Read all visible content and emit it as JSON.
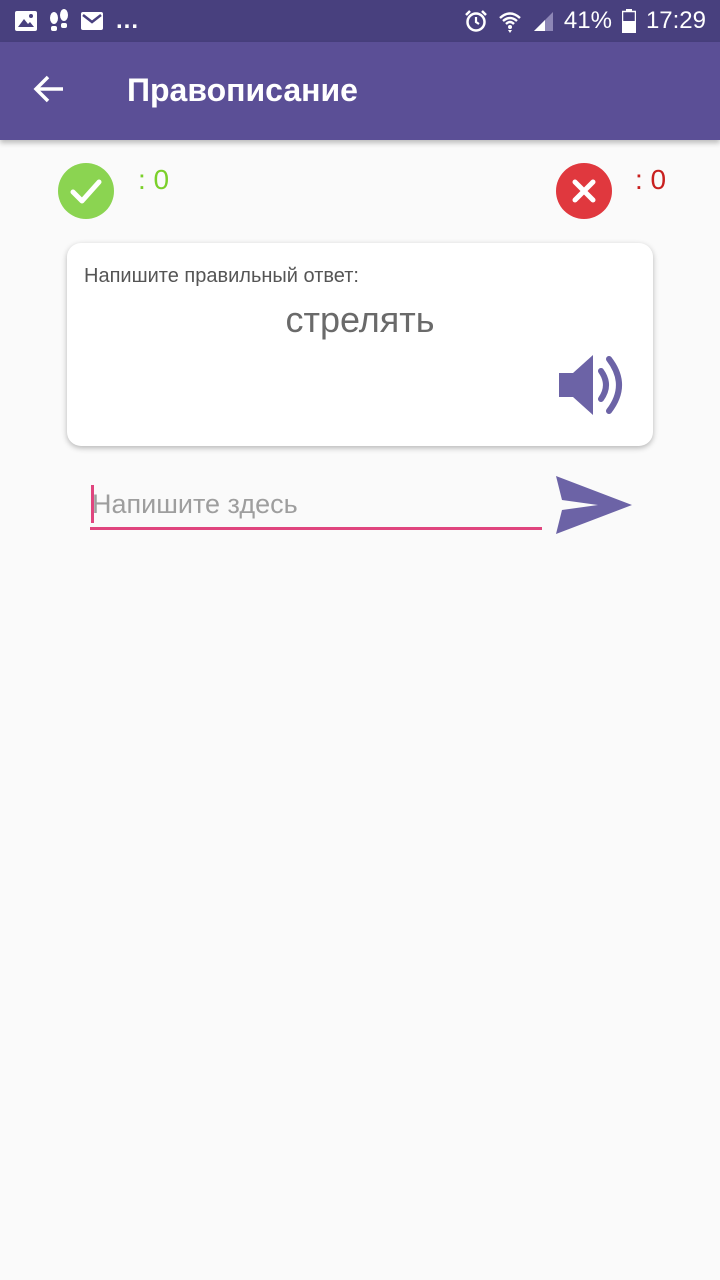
{
  "status_bar": {
    "icons_left": [
      "image-icon",
      "notification-icon",
      "mail-icon"
    ],
    "more": "...",
    "icons_right": [
      "alarm-icon",
      "wifi-icon",
      "signal-icon",
      "battery-icon"
    ],
    "battery": "41%",
    "time": "17:29"
  },
  "appbar": {
    "title": "Правописание",
    "back_icon": "arrow-left-icon"
  },
  "score": {
    "correct_label": ": 0",
    "wrong_label": ": 0",
    "correct_color": "#8bd451",
    "wrong_color": "#e0383e"
  },
  "card": {
    "prompt": "Напишите правильный ответ:",
    "word": "стрелять",
    "speaker_icon": "speaker-icon"
  },
  "answer": {
    "value": "",
    "placeholder": "Напишите здесь",
    "send_icon": "send-icon"
  },
  "colors": {
    "statusbar": "#48407e",
    "appbar": "#5b4f96",
    "accent": "#e0457e",
    "icon_purple": "#6c63a6"
  }
}
